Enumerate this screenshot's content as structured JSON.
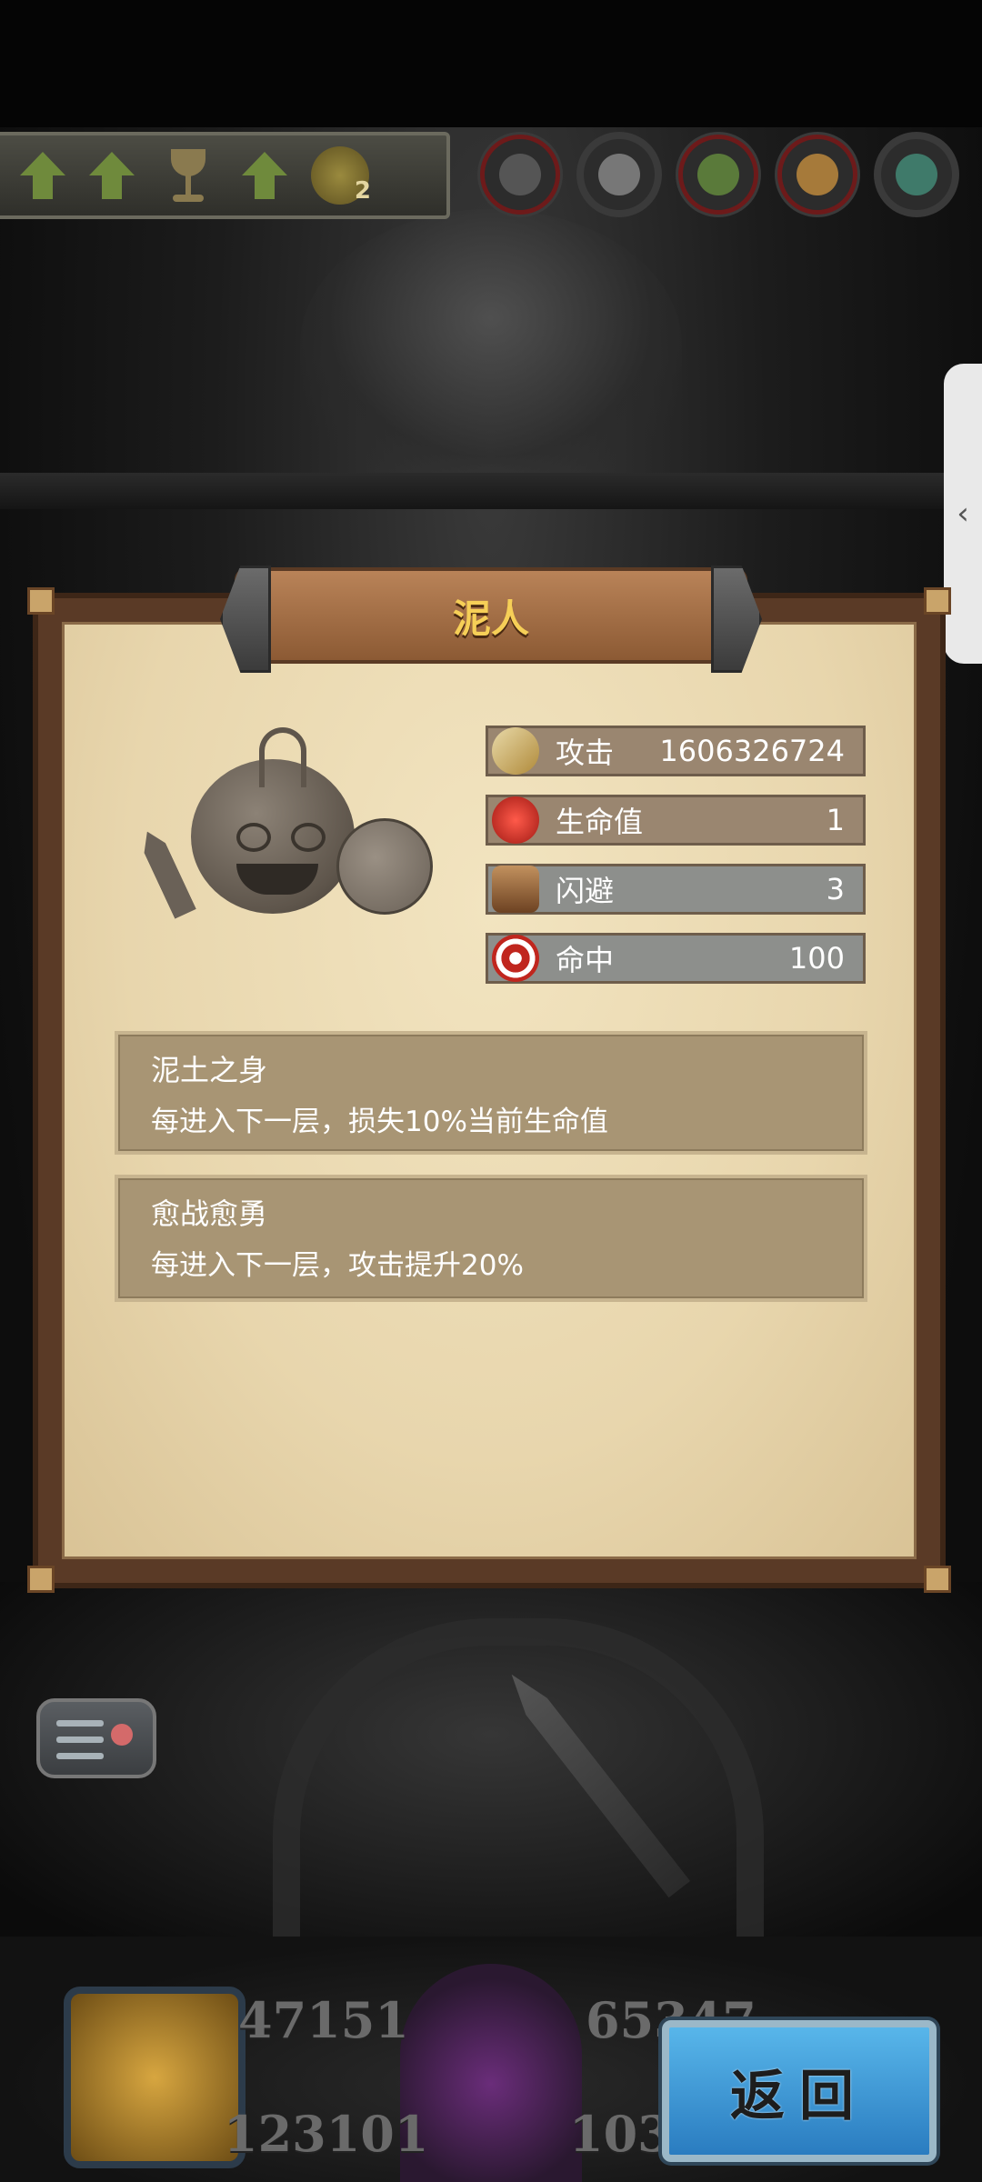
{
  "monster": {
    "name": "泥人",
    "stats": [
      {
        "icon": "sword-icon",
        "label": "攻击",
        "value": "1606326724",
        "color": "#d2b36a"
      },
      {
        "icon": "potion-icon",
        "label": "生命值",
        "value": "1",
        "color": "#c0392b"
      },
      {
        "icon": "boot-icon",
        "label": "闪避",
        "value": "3",
        "color": "#8a5a3a"
      },
      {
        "icon": "target-icon",
        "label": "命中",
        "value": "100",
        "color": "#b22222"
      }
    ],
    "skills": [
      {
        "name": "泥土之身",
        "desc": "每进入下一层，损失10%当前生命值"
      },
      {
        "name": "愈战愈勇",
        "desc": "每进入下一层，攻击提升20%"
      }
    ]
  },
  "buffs": {
    "badge_count": "2"
  },
  "hud": {
    "stat_left_top": "47151",
    "stat_right_top": "65347",
    "stat_left_bottom": "123101",
    "stat_right_bottom": "103"
  },
  "return_button": {
    "label": "返回"
  },
  "side_handle": {
    "glyph": "‹"
  },
  "colors": {
    "panel_bg": "#e8d6ad",
    "title_gold": "#f6cf57",
    "return_blue": "#3a97d6"
  }
}
